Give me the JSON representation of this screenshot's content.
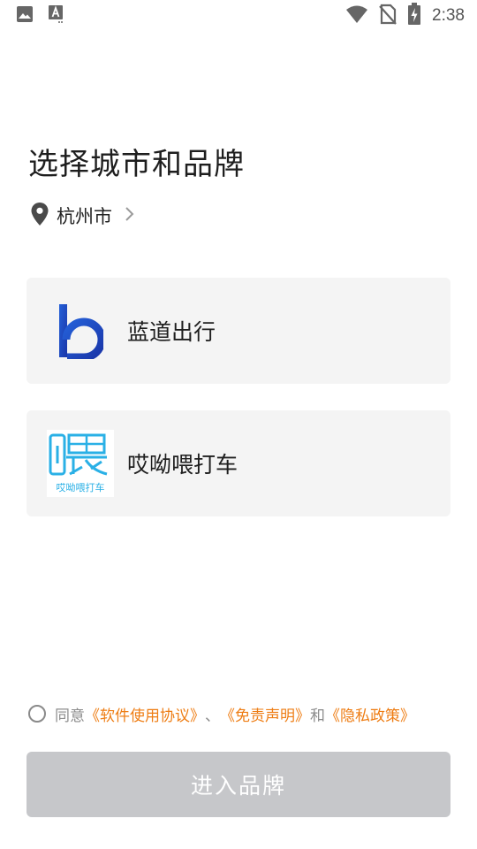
{
  "status_bar": {
    "time": "2:38",
    "icons": [
      "image-icon",
      "a-badge-icon",
      "wifi-icon",
      "no-sim-icon",
      "battery-charging-icon"
    ]
  },
  "page": {
    "title": "选择城市和品牌"
  },
  "city": {
    "name": "杭州市",
    "icon": "location-pin-icon"
  },
  "brands": [
    {
      "name": "蓝道出行",
      "logo_color": "#1f4fc7"
    },
    {
      "name": "哎呦喂打车",
      "logo_text": "哎呦喂打车",
      "logo_color": "#2ab0e6"
    }
  ],
  "agreement": {
    "prefix": "同意",
    "link1": "《软件使用协议》",
    "sep": "、",
    "link2": "《免责声明》",
    "conj": "和",
    "link3": "《隐私政策》",
    "link_color": "#ee7d14"
  },
  "enter_button": {
    "label": "进入品牌"
  }
}
